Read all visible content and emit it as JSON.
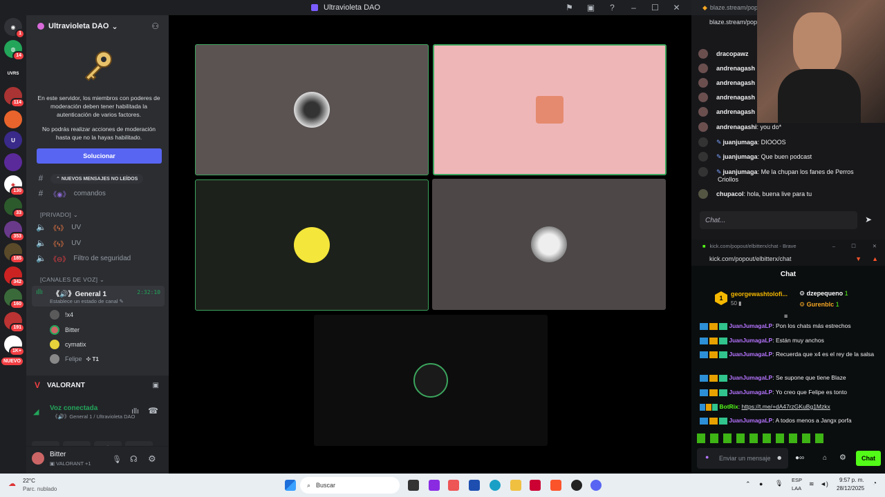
{
  "window": {
    "title": "Ultravioleta DAO"
  },
  "rail": {
    "badges": [
      "1",
      "14",
      "114",
      "130",
      "33",
      "353",
      "185",
      "342",
      "160",
      "191",
      "1K+",
      "1K+"
    ],
    "new_label": "NUEVO"
  },
  "sidebar": {
    "server_name": "Ultravioleta DAO",
    "mfa_notice": "En este servidor, los miembros con poderes de moderación deben tener habilitada la autenticación de varios factores.",
    "mfa_notice2": "No podrás realizar acciones de moderación hasta que no la hayas habilitado.",
    "fix_button": "Solucionar",
    "unread_banner": "NUEVOS MENSAJES NO LEÍDOS",
    "channel_comandos": "comandos",
    "category_private": "PRIVADO",
    "private_channels": [
      "UV",
      "UV",
      "Filtro de seguridad"
    ],
    "category_voice": "CANALES DE VOZ",
    "voice_channel": "General 1",
    "voice_timer": "2:32:10",
    "voice_status": "Establece un estado de canal",
    "voice_users": [
      "!x4",
      "Bitter",
      "cymatix",
      "Felipe"
    ],
    "felipe_tag": "T1",
    "activity": "VALORANT",
    "voice_connected": "Voz conectada",
    "voice_location": "General 1 / Ultravioleta DAO",
    "user_name": "Bitter",
    "user_status": "VALORANT +1"
  },
  "blaze": {
    "tab": "blaze.stream/popout/",
    "url": "blaze.stream/pop",
    "messages": [
      {
        "user": "dracopawz",
        "text": ""
      },
      {
        "user": "andrenagash",
        "text": ""
      },
      {
        "user": "andrenagash",
        "text": ""
      },
      {
        "user": "andrenagash",
        "text": ""
      },
      {
        "user": "andrenagash",
        "text": ""
      },
      {
        "user": "andrenagashi",
        "text": "you do*"
      },
      {
        "user": "juanjumaga",
        "text": "DIOOOS"
      },
      {
        "user": "juanjumaga",
        "text": "Que buen podcast"
      },
      {
        "user": "juanjumaga",
        "text": "Me la chupan los fanes de Perros"
      },
      {
        "user": "",
        "text": "Criollos"
      },
      {
        "user": "chupacol",
        "text": "hola, buena live para tu"
      }
    ],
    "input_placeholder": "Chat..."
  },
  "kick": {
    "window_title": "kick.com/popout/elbitterx/chat - Brave",
    "url": "kick.com/popout/elbitterx/chat",
    "header": "Chat",
    "top_gifter": {
      "name": "georgewashtolofi...",
      "count": "50"
    },
    "gifters": [
      {
        "name": "dzepequeno",
        "count": "1"
      },
      {
        "name": "Gurenblc",
        "count": "1"
      }
    ],
    "messages": [
      {
        "user": "JuanJumagaLP",
        "text": "Pon los chats más estrechos"
      },
      {
        "user": "JuanJumagaLP",
        "text": "Están muy anchos"
      },
      {
        "user": "JuanJumagaLP",
        "text": "Recuerda que x4 es el rey de la salsa"
      },
      {
        "user": "JuanJumagaLP",
        "text": "Se supone que tiene Blaze"
      },
      {
        "user": "JuanJumagaLP",
        "text": "Yo creo que Felipe es tonto"
      },
      {
        "user": "BotRix",
        "text": "https://t.me/+dA47rzGKuBg1Mzkx"
      },
      {
        "user": "JuanJumagaLP",
        "text": "A todos menos a Jangx porfa"
      }
    ],
    "input_placeholder": "Enviar un mensaje",
    "chat_button": "Chat"
  },
  "taskbar": {
    "weather_temp": "22°C",
    "weather_desc": "Parc. nublado",
    "search": "Buscar",
    "lang1": "ESP",
    "lang2": "LAA",
    "time": "9:57 p. m.",
    "date": "28/12/2025"
  },
  "colors": {
    "discord_bg": "#2b2d31",
    "blurple": "#5865f2",
    "kick_green": "#53fc18",
    "speaking_border": "#3ba55d"
  }
}
